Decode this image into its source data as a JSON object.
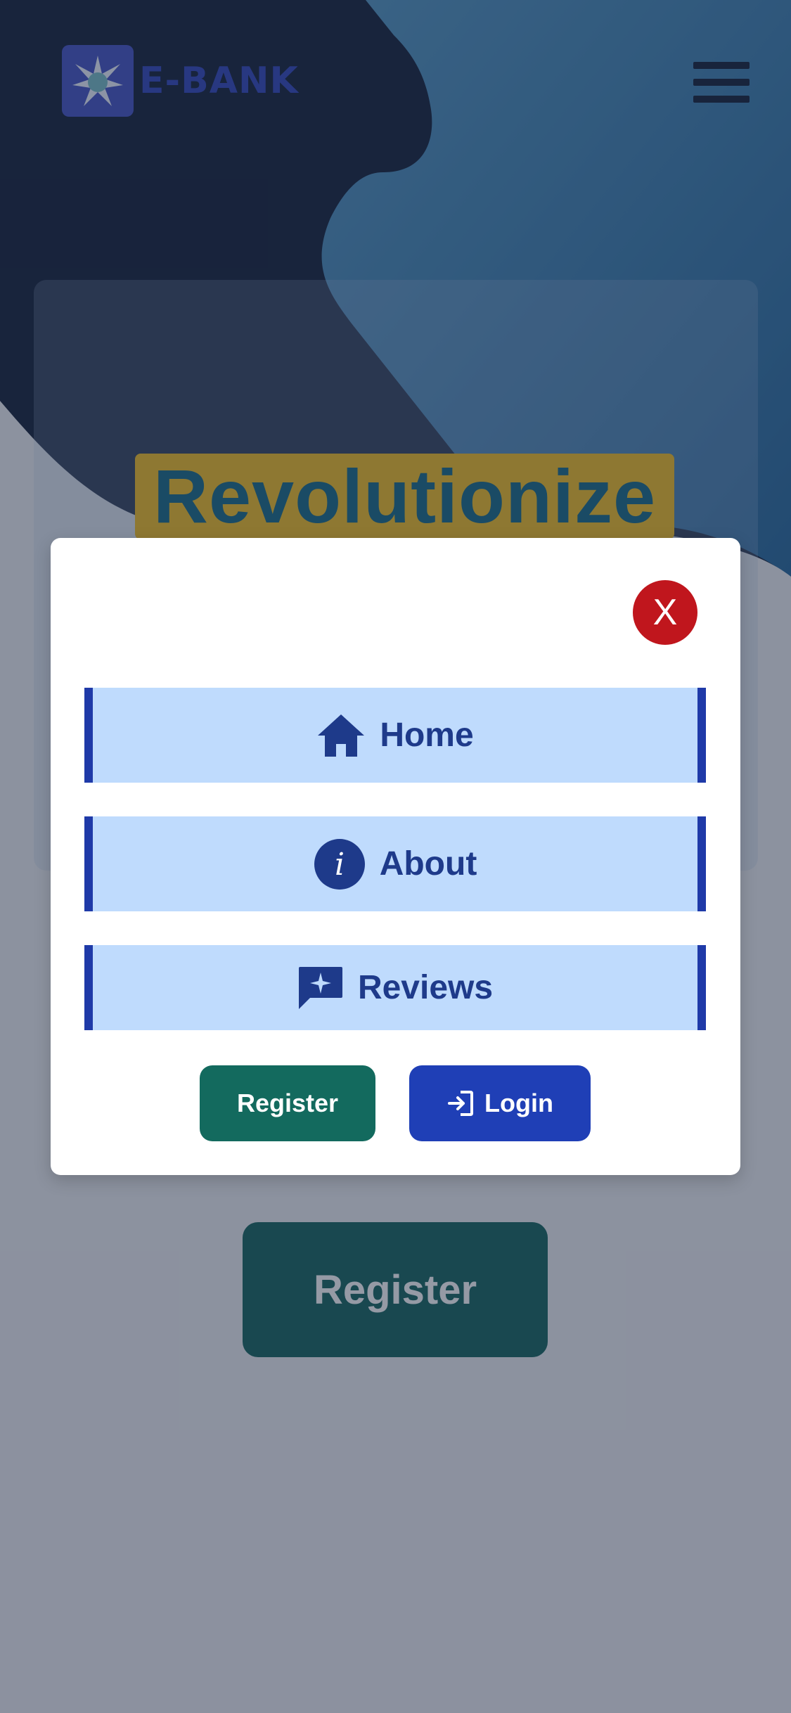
{
  "brand": {
    "name": "E-BANK"
  },
  "hero": {
    "title": "Revolutionize",
    "register_label": "Register"
  },
  "menu": {
    "close_label": "X",
    "items": [
      {
        "label": "Home",
        "icon": "home-icon"
      },
      {
        "label": "About",
        "icon": "info-icon"
      },
      {
        "label": "Reviews",
        "icon": "reviews-icon"
      }
    ],
    "register_label": "Register",
    "login_label": "Login",
    "login_icon": "login-icon"
  },
  "colors": {
    "dark_navy": "#1c2840",
    "hero_blue": "#4b86b4",
    "accent_yellow": "#f2c12f",
    "title_teal": "#1f6f8b",
    "nav_bg": "#bfdbfd",
    "nav_border": "#1f3aa8",
    "register_green": "#136a5e",
    "login_blue": "#1f3fb6",
    "close_red": "#c0161d"
  }
}
